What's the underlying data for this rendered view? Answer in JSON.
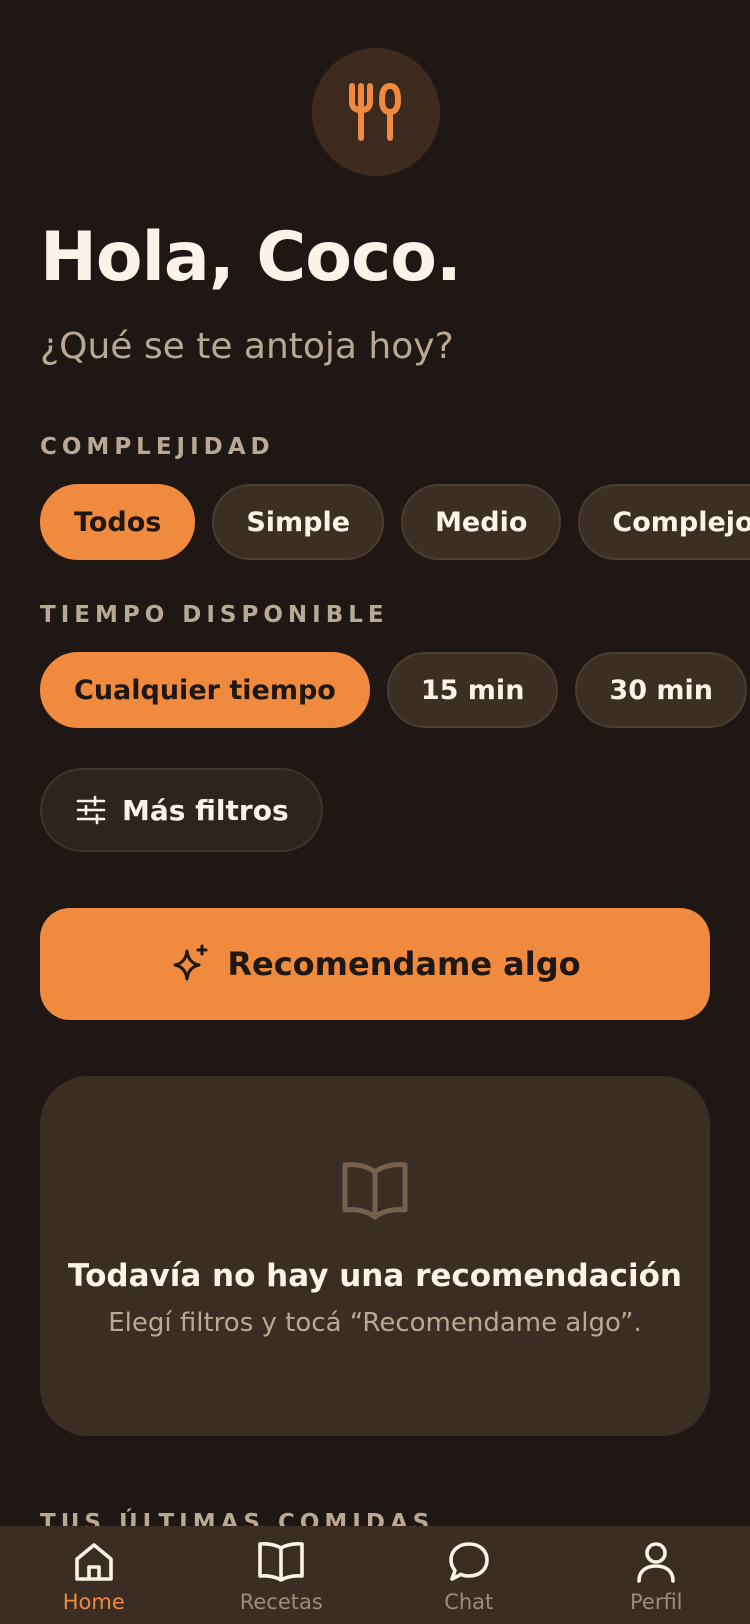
{
  "greeting": "Hola, Coco.",
  "subtitle": "¿Qué se te antoja hoy?",
  "complexity": {
    "label": "COMPLEJIDAD",
    "options": [
      "Todos",
      "Simple",
      "Medio",
      "Complejo"
    ],
    "selected": "Todos"
  },
  "time": {
    "label": "TIEMPO DISPONIBLE",
    "options": [
      "Cualquier tiempo",
      "15 min",
      "30 min",
      ""
    ],
    "selected": "Cualquier tiempo"
  },
  "more_filters_label": "Más filtros",
  "recommend_label": "Recomendame algo",
  "empty_state": {
    "title": "Todavía no hay una recomendación",
    "description": "Elegí filtros y tocá “Recomendame algo”."
  },
  "recent_label": "TUS ÚLTIMAS COMIDAS",
  "tabs": [
    {
      "label": "Home",
      "icon": "home-icon"
    },
    {
      "label": "Recetas",
      "icon": "book-icon"
    },
    {
      "label": "Chat",
      "icon": "chat-bubble-icon"
    },
    {
      "label": "Perfil",
      "icon": "user-icon"
    }
  ],
  "colors": {
    "background": "#1e1714",
    "accent": "#f08a3e",
    "surface": "#3a2d23",
    "muted_text": "#b9a894"
  }
}
